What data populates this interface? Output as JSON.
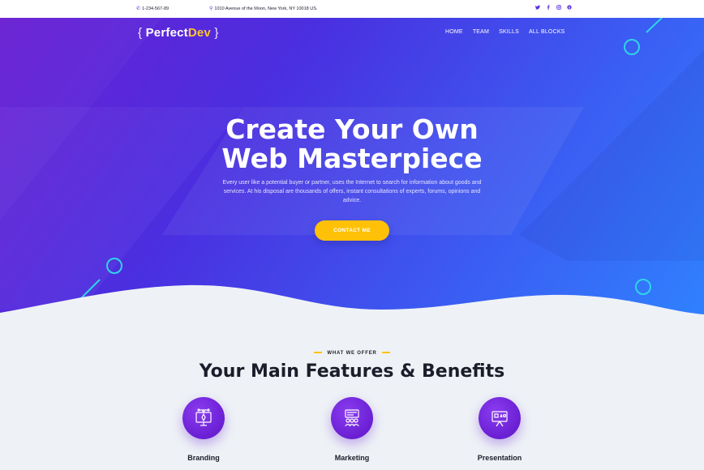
{
  "topbar": {
    "phone": "1-234-567-89",
    "address": "1010 Avenue of the Moon, New York, NY 10018 US.",
    "socials": [
      "twitter-icon",
      "facebook-icon",
      "instagram-icon",
      "skype-icon"
    ]
  },
  "logo": {
    "open_brace": "{",
    "name_main": "Perfect",
    "name_accent": "Dev",
    "close_brace": "}"
  },
  "nav": {
    "items": [
      "HOME",
      "TEAM",
      "SKILLS",
      "ALL BLOCKS"
    ]
  },
  "hero": {
    "title_line1": "Create Your Own",
    "title_line2": "Web Masterpiece",
    "subtitle": "Every user like a potential buyer or partner, uses the Internet to search for information about goods and services. At his disposal are thousands of offers, instant consultations of experts, forums, opinions and advice.",
    "cta_label": "CONTACT ME"
  },
  "features": {
    "eyebrow": "WHAT WE OFFER",
    "title": "Your Main Features & Benefits",
    "items": [
      {
        "label": "Branding",
        "icon": "monitor-pen-icon"
      },
      {
        "label": "Marketing",
        "icon": "audience-board-icon"
      },
      {
        "label": "Presentation",
        "icon": "presentation-board-icon"
      }
    ]
  },
  "colors": {
    "accent": "#ffc107",
    "brand_purple": "#6a1fd3",
    "brand_blue": "#2f82ff"
  }
}
